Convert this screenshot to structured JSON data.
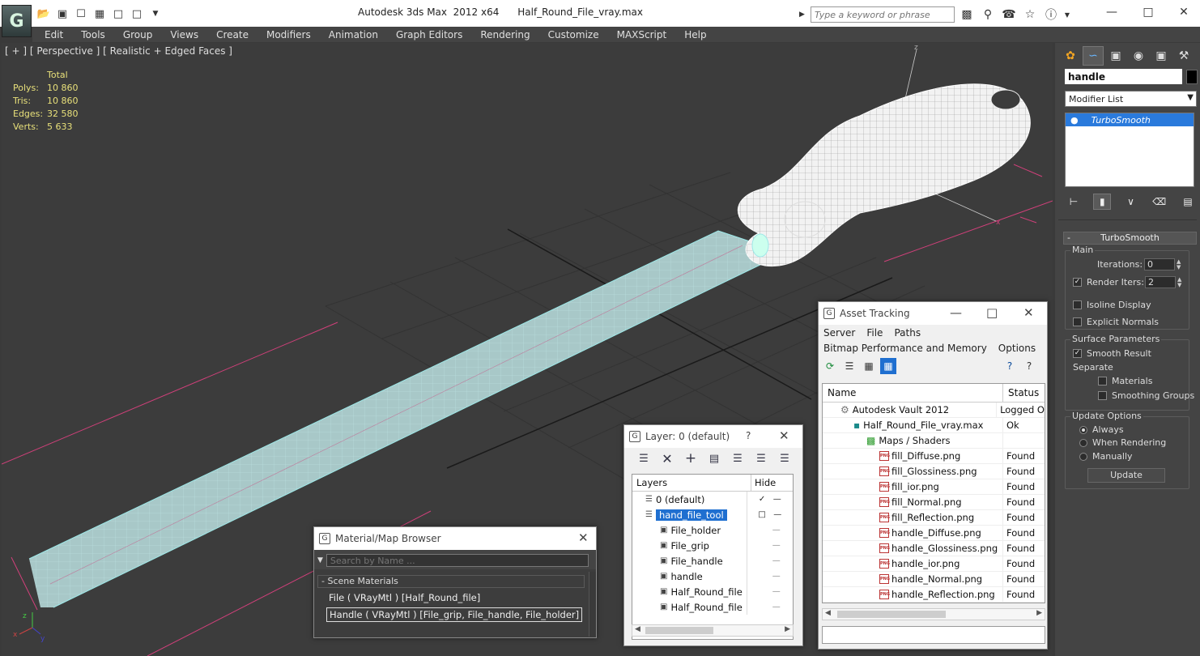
{
  "app": {
    "title": "Autodesk 3ds Max  2012 x64",
    "filename": "Half_Round_File_vray.max",
    "logo_glyph": "G"
  },
  "search": {
    "placeholder": "Type a keyword or phrase"
  },
  "menu": [
    "Edit",
    "Tools",
    "Group",
    "Views",
    "Create",
    "Modifiers",
    "Animation",
    "Graph Editors",
    "Rendering",
    "Customize",
    "MAXScript",
    "Help"
  ],
  "viewport": {
    "label": "[ + ] [ Perspective ] [ Realistic + Edged Faces ]",
    "stats": {
      "header": "Total",
      "rows": [
        {
          "k": "Polys:",
          "v": "10 860"
        },
        {
          "k": "Tris:",
          "v": "10 860"
        },
        {
          "k": "Edges:",
          "v": "32 580"
        },
        {
          "k": "Verts:",
          "v": "5 633"
        }
      ]
    },
    "axis": {
      "x": "x",
      "y": "y",
      "z": "z"
    }
  },
  "command_panel": {
    "object_name": "handle",
    "modifier_list": "Modifier List",
    "stack_item": "TurboSmooth",
    "rollout": "TurboSmooth",
    "main": {
      "label": "Main",
      "iterations_label": "Iterations:",
      "iterations": "0",
      "render_iters_label": "Render Iters:",
      "render_iters": "2",
      "isoline": "Isoline Display",
      "explicit": "Explicit Normals"
    },
    "surface": {
      "label": "Surface Parameters",
      "smooth": "Smooth Result",
      "separate": "Separate",
      "materials": "Materials",
      "smoothing_groups": "Smoothing Groups"
    },
    "update": {
      "label": "Update Options",
      "always": "Always",
      "when_rendering": "When Rendering",
      "manually": "Manually",
      "button": "Update"
    }
  },
  "asset_tracking": {
    "title": "Asset Tracking",
    "menu1": [
      "Server",
      "File",
      "Paths"
    ],
    "menu2": [
      "Bitmap Performance and Memory",
      "Options"
    ],
    "col_name": "Name",
    "col_status": "Status",
    "rows": [
      {
        "name": "Autodesk Vault 2012",
        "status": "Logged O",
        "indent": 1,
        "icon": "vault"
      },
      {
        "name": "Half_Round_File_vray.max",
        "status": "Ok",
        "indent": 2,
        "icon": "max"
      },
      {
        "name": "Maps / Shaders",
        "status": "",
        "indent": 3,
        "icon": "maps"
      },
      {
        "name": "fill_Diffuse.png",
        "status": "Found",
        "indent": 4,
        "icon": "png"
      },
      {
        "name": "fill_Glossiness.png",
        "status": "Found",
        "indent": 4,
        "icon": "png"
      },
      {
        "name": "fill_ior.png",
        "status": "Found",
        "indent": 4,
        "icon": "png"
      },
      {
        "name": "fill_Normal.png",
        "status": "Found",
        "indent": 4,
        "icon": "png"
      },
      {
        "name": "fill_Reflection.png",
        "status": "Found",
        "indent": 4,
        "icon": "png"
      },
      {
        "name": "handle_Diffuse.png",
        "status": "Found",
        "indent": 4,
        "icon": "png"
      },
      {
        "name": "handle_Glossiness.png",
        "status": "Found",
        "indent": 4,
        "icon": "png"
      },
      {
        "name": "handle_ior.png",
        "status": "Found",
        "indent": 4,
        "icon": "png"
      },
      {
        "name": "handle_Normal.png",
        "status": "Found",
        "indent": 4,
        "icon": "png"
      },
      {
        "name": "handle_Reflection.png",
        "status": "Found",
        "indent": 4,
        "icon": "png"
      }
    ]
  },
  "layer_dialog": {
    "title": "Layer: 0 (default)",
    "help": "?",
    "col_layers": "Layers",
    "col_hide": "Hide",
    "rows": [
      {
        "name": "0 (default)",
        "type": "layer",
        "indent": 1,
        "selected": false,
        "check": true
      },
      {
        "name": "hand_file_tool",
        "type": "layer",
        "indent": 1,
        "selected": true,
        "check": false
      },
      {
        "name": "File_holder",
        "type": "object",
        "indent": 2,
        "selected": false,
        "check": false
      },
      {
        "name": "File_grip",
        "type": "object",
        "indent": 2,
        "selected": false,
        "check": false
      },
      {
        "name": "File_handle",
        "type": "object",
        "indent": 2,
        "selected": false,
        "check": false
      },
      {
        "name": "handle",
        "type": "object",
        "indent": 2,
        "selected": false,
        "check": false
      },
      {
        "name": "Half_Round_file",
        "type": "object",
        "indent": 2,
        "selected": false,
        "check": false
      },
      {
        "name": "Half_Round_file",
        "type": "object",
        "indent": 2,
        "selected": false,
        "check": false
      }
    ]
  },
  "material_browser": {
    "title": "Material/Map Browser",
    "search_placeholder": "Search by Name ...",
    "group": "- Scene Materials",
    "items": [
      "File  ( VRayMtl )  [Half_Round_file]",
      "Handle  ( VRayMtl )  [File_grip, File_handle, File_holder]"
    ]
  }
}
